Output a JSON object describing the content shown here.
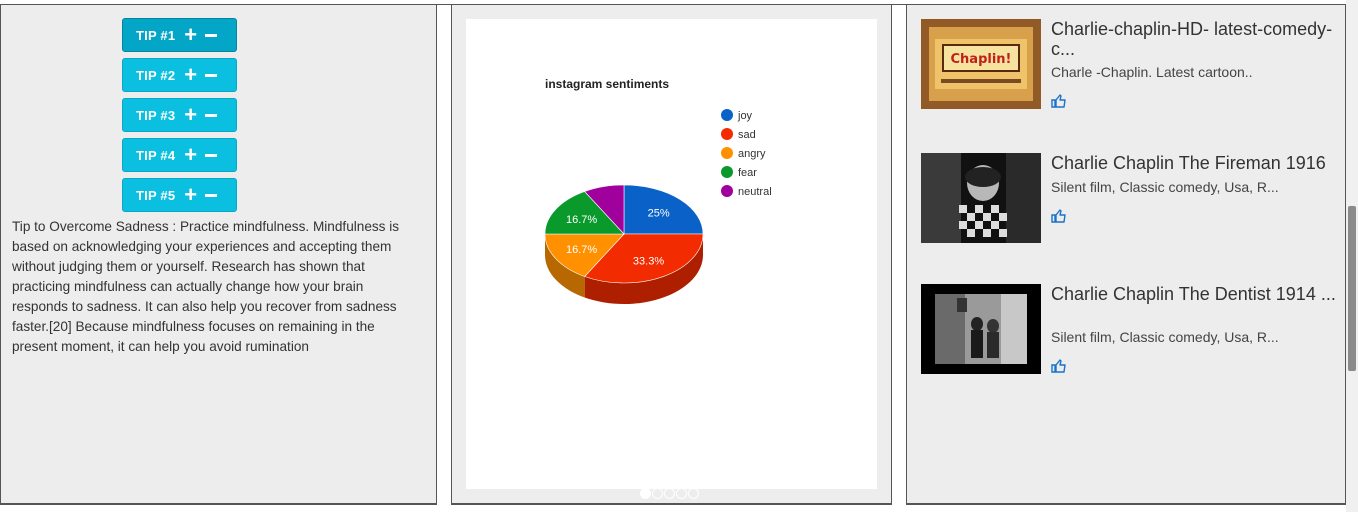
{
  "tips": {
    "buttons": [
      {
        "label": "TIP #1"
      },
      {
        "label": "TIP #2"
      },
      {
        "label": "TIP #3"
      },
      {
        "label": "TIP #4"
      },
      {
        "label": "TIP #5"
      }
    ],
    "text": "Tip to Overcome Sadness : Practice mindfulness. Mindfulness is based on acknowledging your experiences and accepting them without judging them or yourself. Research has shown that practicing mindfulness can actually change how your brain responds to sadness. It can also help you recover from sadness faster.[20] Because mindfulness focuses on remaining in the present moment, it can help you avoid rumination"
  },
  "chart_data": {
    "type": "pie",
    "title": "instagram sentiments",
    "series": [
      {
        "label": "joy",
        "value": 25,
        "display": "25%",
        "color": "#0a62c8"
      },
      {
        "label": "sad",
        "value": 33.3,
        "display": "33.3%",
        "color": "#f22b00"
      },
      {
        "label": "angry",
        "value": 16.7,
        "display": "16.7%",
        "color": "#ff9000"
      },
      {
        "label": "fear",
        "value": 16.7,
        "display": "16.7%",
        "color": "#0a9a2c"
      },
      {
        "label": "neutral",
        "value": 8.3,
        "display": "",
        "color": "#a0009c"
      }
    ],
    "legend_position": "right",
    "style": "3d"
  },
  "carousel": {
    "active_index": 0,
    "count": 5
  },
  "videos": [
    {
      "title": "Charlie-chaplin-HD- latest-comedy-c...",
      "description": "Charle -Chaplin. Latest cartoon..",
      "thumb_text": "Chaplin!"
    },
    {
      "title": "Charlie Chaplin The Fireman 1916",
      "description": "Silent film, Classic comedy, Usa, R..."
    },
    {
      "title": "Charlie Chaplin The Dentist 1914 ...",
      "description": "Silent film, Classic comedy, Usa, R..."
    }
  ],
  "colors": {
    "accent": "#0bbfe0",
    "accent_active": "#04a6c7",
    "link": "#1a73c8"
  }
}
